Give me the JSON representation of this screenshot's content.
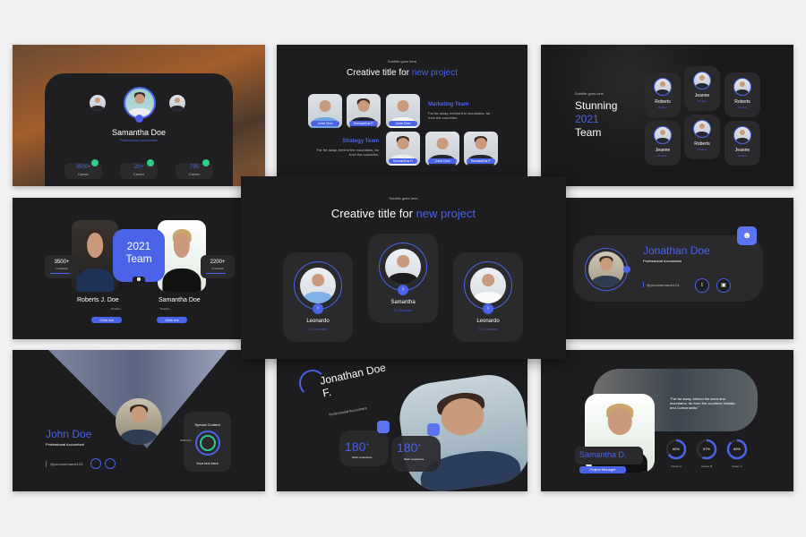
{
  "colors": {
    "accent": "#4a63e8",
    "background": "#1d1d1f",
    "card": "#2a2a2d",
    "green": "#2ecc8a"
  },
  "slide1": {
    "name": "Samantha Doe",
    "role": "Professional Accountant",
    "stats": [
      {
        "value": "3500+",
        "label": "Career"
      },
      {
        "value": "20+",
        "label": "Career"
      },
      {
        "value": "795",
        "label": "Career"
      }
    ]
  },
  "slide2": {
    "subtitle": "Subtitle goes here",
    "title": "Creative title for ",
    "title_accent": "new project",
    "row1": [
      "John Doe",
      "Samantha P.",
      "John Doe"
    ],
    "row2": [
      "Samantha P.",
      "John Doe",
      "Samantha P."
    ],
    "marketing": {
      "title": "Marketing Team",
      "desc": "Far far away, behind the mountains, far from the countries."
    },
    "strategy": {
      "title": "Strategy Team",
      "desc": "Far far away, behind the mountains, far from the countries."
    }
  },
  "slide3": {
    "subtitle": "Subtitle goes here",
    "line1": "Stunning",
    "line2": "2021",
    "line3": "Team",
    "members": [
      {
        "name": "Roberts",
        "role": "Position"
      },
      {
        "name": "Jeanne",
        "role": "Position"
      },
      {
        "name": "Roberts",
        "role": "Position"
      },
      {
        "name": "Jeanne",
        "role": "Position"
      },
      {
        "name": "Roberts",
        "role": "Position"
      },
      {
        "name": "Jeanne",
        "role": "Position"
      }
    ]
  },
  "slide4": {
    "badge_line1": "2021",
    "badge_line2": "Team",
    "left": {
      "stat": "3500+",
      "stat_label": "Feedback",
      "name": "Roberts J. Doe",
      "role": "Position",
      "button": "Click me"
    },
    "right": {
      "stat": "2200+",
      "stat_label": "Feedback",
      "name": "Samantha Doe",
      "role": "Position",
      "button": "Click me"
    }
  },
  "center": {
    "subtitle": "Subtitle goes here",
    "title": "Creative title for ",
    "title_accent": "new project",
    "members": [
      {
        "name": "Leonardo",
        "role": "Co Founder"
      },
      {
        "name": "Samantha",
        "role": "Co Founder"
      },
      {
        "name": "Leonardo",
        "role": "Co Founder"
      }
    ]
  },
  "slide6": {
    "name": "Jonathan Doe",
    "role": "Professional Accountant",
    "handle": "@yourusername123"
  },
  "slide7": {
    "name": "John Doe",
    "role": "Professional Accountant",
    "handle": "@yourusername123",
    "special_title": "Special Content",
    "special_tag": "SPECIAL",
    "special_text": "Your text here"
  },
  "slide8": {
    "name_line1": "Jonathan Doe",
    "name_line2": "F.",
    "role": "Professional Accountant",
    "stats": [
      {
        "value": "180",
        "sup": "+",
        "label": "Work experience"
      },
      {
        "value": "180",
        "sup": "+",
        "label": "Work experience"
      }
    ]
  },
  "slide9": {
    "quote": "\"Far far away, behind the word and mountains, far from the countries Vokalia and Consonantia.\"",
    "name": "Samantha D.",
    "role": "Project Manager",
    "rings": [
      {
        "value": "65%",
        "pct": 65,
        "label": "Career A"
      },
      {
        "value": "57%",
        "pct": 57,
        "label": "Career B"
      },
      {
        "value": "88%",
        "pct": 88,
        "label": "Career C"
      }
    ]
  }
}
